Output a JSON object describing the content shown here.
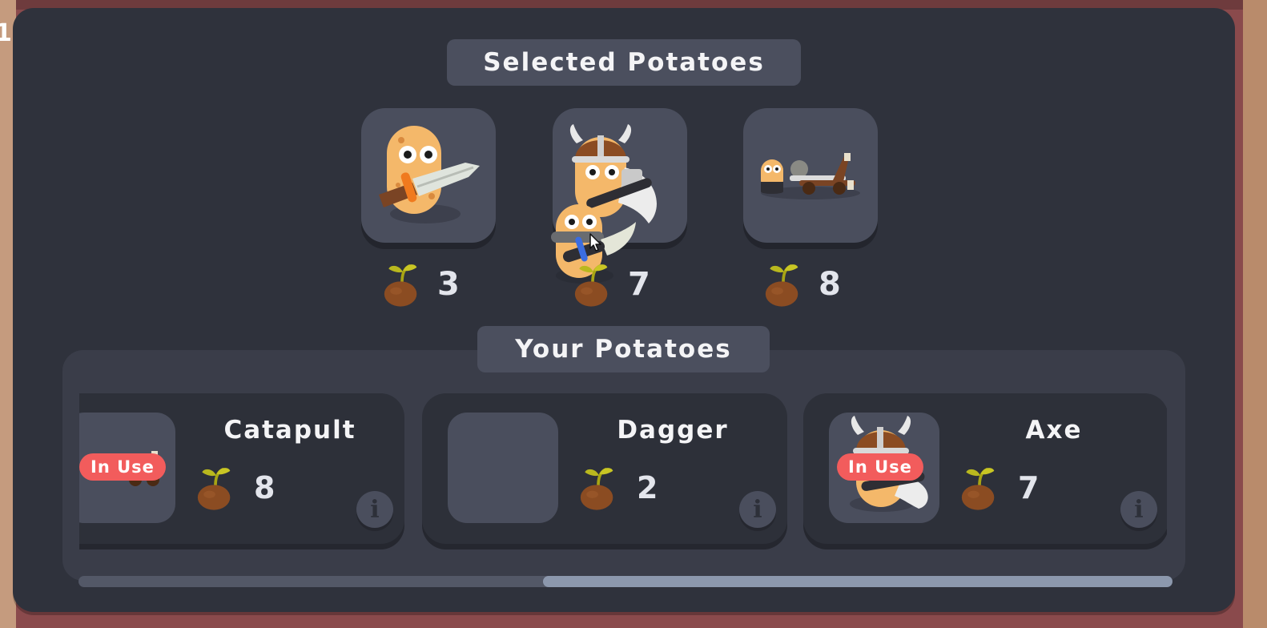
{
  "corner_label": "1",
  "selected": {
    "title": "Selected Potatoes",
    "slots": [
      {
        "icon": "sword-potato-icon",
        "cost": "3"
      },
      {
        "icon": "viking-axe-and-dagger-potato-icon",
        "cost": "7"
      },
      {
        "icon": "catapult-potato-icon",
        "cost": "8"
      }
    ]
  },
  "inventory": {
    "title": "Your Potatoes",
    "cards": [
      {
        "name": "Catapult",
        "cost": "8",
        "badge": "In Use",
        "icon": "catapult-potato-icon"
      },
      {
        "name": "Dagger",
        "cost": "2",
        "badge": "",
        "icon": ""
      },
      {
        "name": "Axe",
        "cost": "7",
        "badge": "In Use",
        "icon": "viking-axe-potato-icon"
      }
    ],
    "info_label": "i",
    "scroll_position": 0.43
  },
  "colors": {
    "panel": "#2f323c",
    "card": "#4a4e5d",
    "badge": "#f25c5c",
    "seed": "#8a4a22",
    "sprout": "#b7b81a"
  }
}
